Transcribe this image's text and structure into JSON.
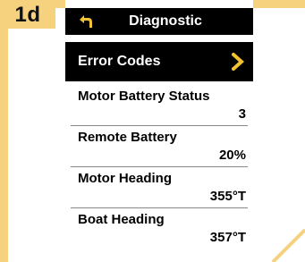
{
  "step": "1d",
  "header": {
    "title": "Diagnostic"
  },
  "error_codes": {
    "label": "Error Codes"
  },
  "items": [
    {
      "name": "Motor Battery Status",
      "value": "3"
    },
    {
      "name": "Remote Battery",
      "value": "20%"
    },
    {
      "name": "Motor Heading",
      "value": "355°T"
    },
    {
      "name": "Boat Heading",
      "value": "357°T"
    }
  ],
  "colors": {
    "frame": "#f7d27e",
    "screen_bg": "#ffffff",
    "bar_bg": "#000000",
    "chevron": "#f2c230"
  },
  "icons": {
    "back": "back-arrow-icon",
    "chevron": "chevron-right-icon"
  }
}
